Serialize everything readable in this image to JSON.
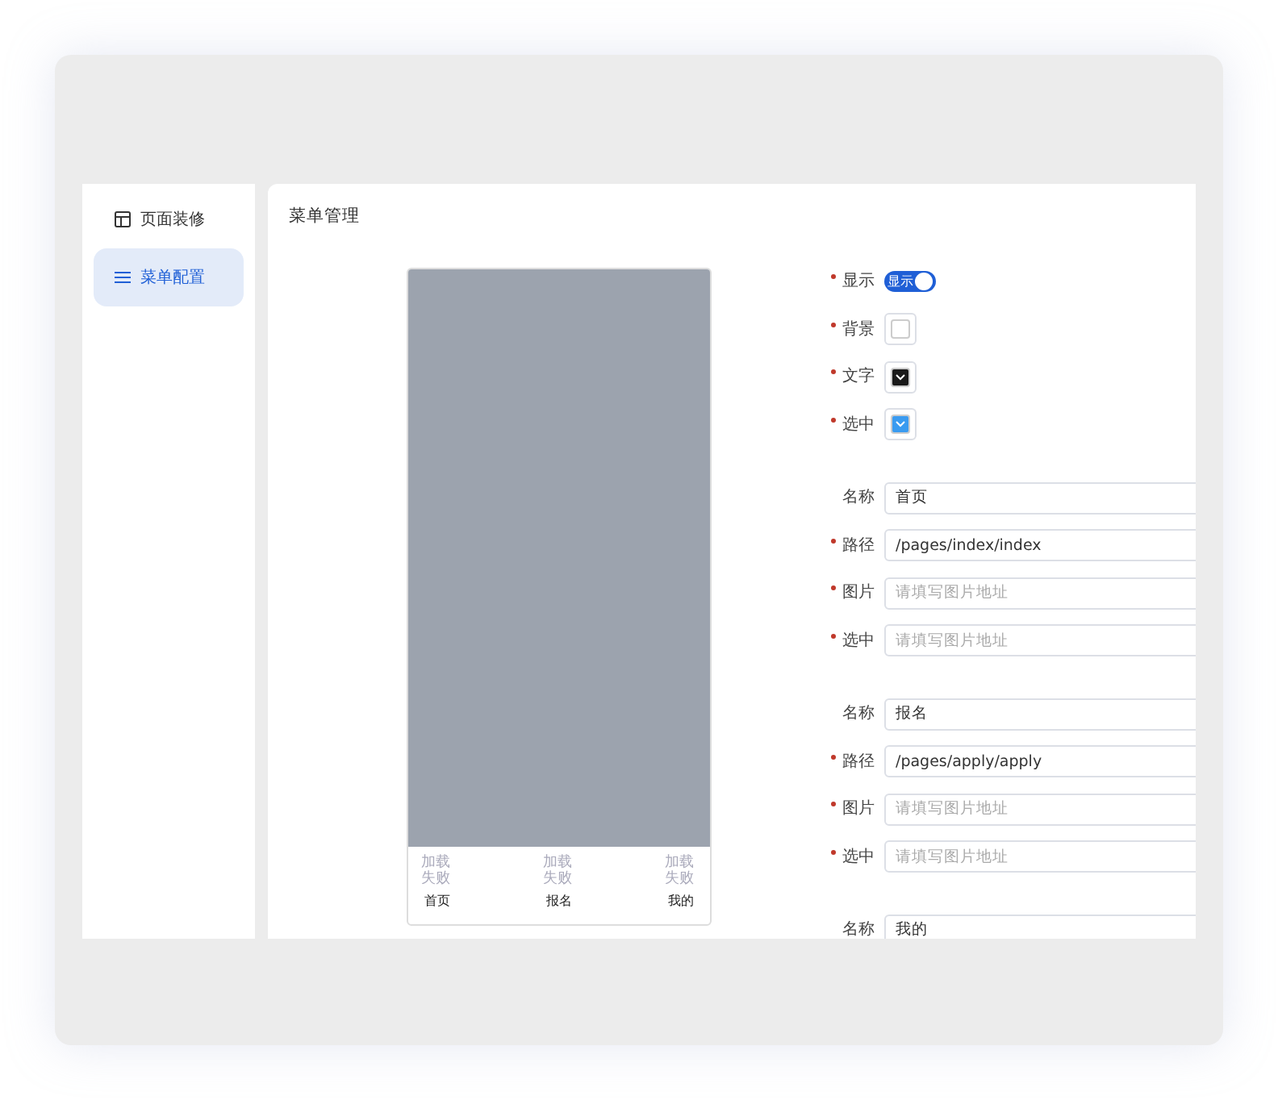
{
  "sidebar": {
    "items": [
      {
        "label": "页面装修",
        "selected": false
      },
      {
        "label": "菜单配置",
        "selected": true
      }
    ]
  },
  "panel": {
    "title": "菜单管理"
  },
  "preview": {
    "tabs": [
      {
        "image_text": "加载失败",
        "label": "首页"
      },
      {
        "image_text": "加载失败",
        "label": "报名"
      },
      {
        "image_text": "加载失败",
        "label": "我的"
      }
    ]
  },
  "settings": [
    {
      "kind": "toggle",
      "label": "显示",
      "required": true,
      "on": true,
      "text": "显示"
    },
    {
      "kind": "color",
      "label": "背景",
      "required": true,
      "color": "#ffffff"
    },
    {
      "kind": "color",
      "label": "文字",
      "required": true,
      "color": "#1a1a1a"
    },
    {
      "kind": "color",
      "label": "选中",
      "required": true,
      "color": "#3a9bf0"
    }
  ],
  "menu_items": [
    {
      "fields": [
        {
          "label": "名称",
          "required": false,
          "value": "首页"
        },
        {
          "label": "路径",
          "required": true,
          "value": "/pages/index/index"
        },
        {
          "label": "图片",
          "required": true,
          "placeholder": "请填写图片地址"
        },
        {
          "label": "选中",
          "required": true,
          "placeholder": "请填写图片地址"
        }
      ]
    },
    {
      "fields": [
        {
          "label": "名称",
          "required": false,
          "value": "报名"
        },
        {
          "label": "路径",
          "required": true,
          "value": "/pages/apply/apply"
        },
        {
          "label": "图片",
          "required": true,
          "placeholder": "请填写图片地址"
        },
        {
          "label": "选中",
          "required": true,
          "placeholder": "请填写图片地址"
        }
      ]
    },
    {
      "fields": [
        {
          "label": "名称",
          "required": false,
          "value": "我的"
        }
      ]
    }
  ]
}
